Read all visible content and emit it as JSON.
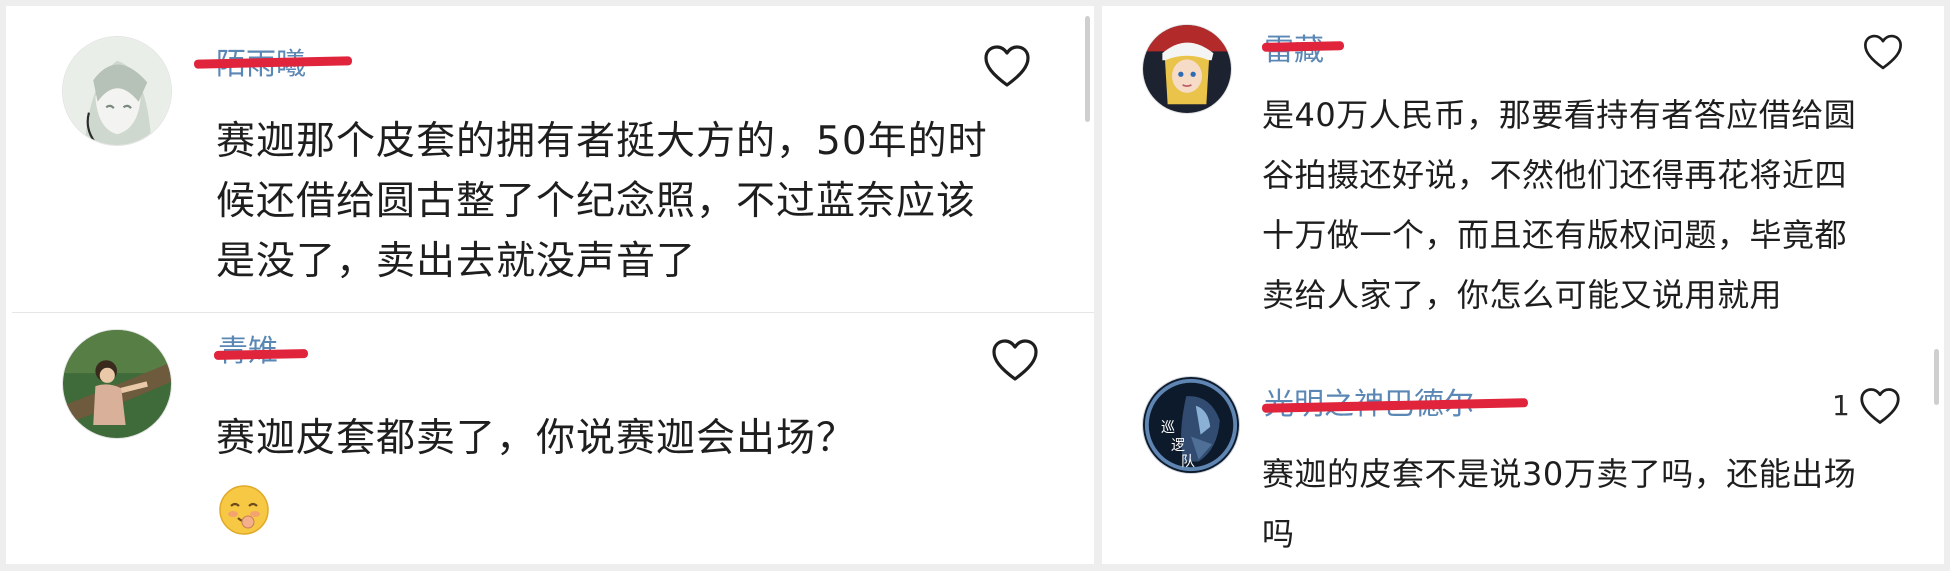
{
  "left_panel": {
    "comments": [
      {
        "username": "陌雨曦",
        "text": "赛迦那个皮套的拥有者挺大方的，50年的时候还借给圆古整了个纪念照，不过蓝奈应该是没了，卖出去就没声音了"
      },
      {
        "username": "青雉",
        "text": "赛迦皮套都卖了，你说赛迦会出场？",
        "emoji": "face-savoring-icon"
      }
    ]
  },
  "right_panel": {
    "comments": [
      {
        "username": "雷藏",
        "text": "是40万人民币，那要看持有者答应借给圆谷拍摄还好说，不然他们还得再花将近四十万做一个，而且还有版权问题，毕竟都卖给人家了，你怎么可能又说用就用"
      },
      {
        "username": "光明之神巴德尔",
        "text": "赛迦的皮套不是说30万卖了吗，还能出场吗",
        "like_count": "1",
        "avatar_text": [
          "巡",
          "逻",
          "队"
        ]
      }
    ]
  },
  "colors": {
    "username": "#5b87b5",
    "redaction": "#e0243c",
    "text": "#1e1e1e"
  }
}
